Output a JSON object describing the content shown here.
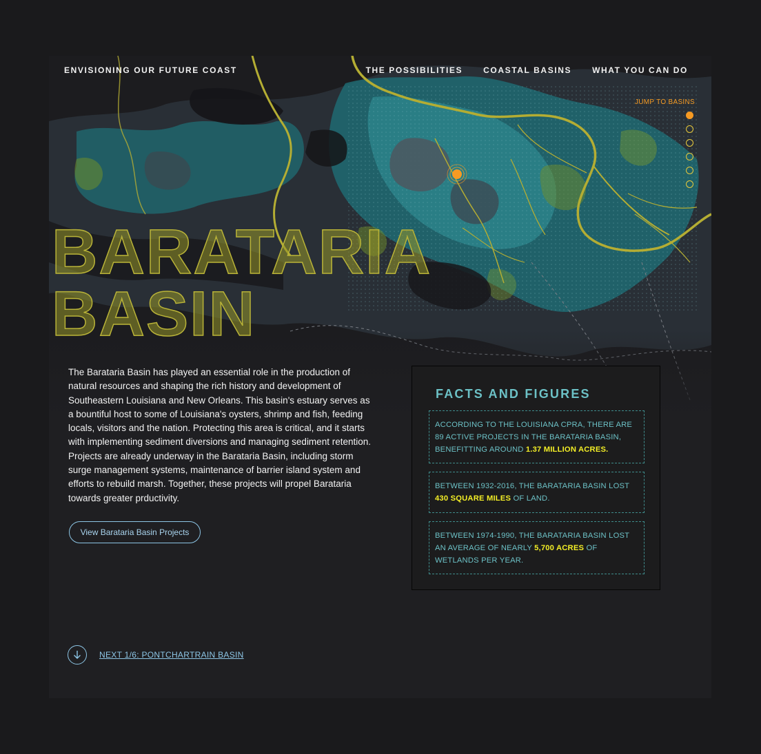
{
  "nav": {
    "brand": "ENVISIONING OUR FUTURE COAST",
    "links": [
      "THE POSSIBILITIES",
      "COASTAL BASINS",
      "WHAT YOU CAN DO"
    ]
  },
  "sidebar": {
    "jump_label": "JUMP TO BASINS",
    "basin_count": 6,
    "active_index": 0
  },
  "hero": {
    "title_line1": "BARATARIA",
    "title_line2": "BASIN"
  },
  "description": "The Barataria Basin has played an essential role in the production of natural resources and shaping the rich history and development of Southeastern Louisiana and New Orleans. This basin's estuary serves as a bountiful host to some of Louisiana's oysters, shrimp and fish, feeding locals, visitors and the nation. Protecting this area is critical, and it starts with implementing sediment diversions and managing sediment retention. Projects are already underway in the Barataria Basin, including storm surge management systems, maintenance of barrier island system and efforts to rebuild marsh. Together, these projects will propel Barataria towards greater prductivity.",
  "cta_label": "View Barataria Basin Projects",
  "facts": {
    "title": "FACTS AND FIGURES",
    "items": [
      {
        "before": "According to the Louisiana CPRA, there are 89 active projects in the Barataria Basin, benefitting around ",
        "highlight": "1.37 million acres.",
        "after": ""
      },
      {
        "before": "Between 1932-2016, the Barataria Basin lost ",
        "highlight": "430 square miles",
        "after": " of land."
      },
      {
        "before": "Between 1974-1990, the Barataria Basin lost an average of nearly ",
        "highlight": "5,700 acres",
        "after": " of wetlands per year."
      }
    ]
  },
  "next_label": "NEXT 1/6: PONTCHARTRAIN BASIN",
  "colors": {
    "background": "#1f1f22",
    "accent_orange": "#f59a23",
    "teal": "#6cc1c6",
    "highlight_yellow": "#f4ef26",
    "river_yellow": "#b9b338",
    "link_blue": "#8dc6e6"
  }
}
